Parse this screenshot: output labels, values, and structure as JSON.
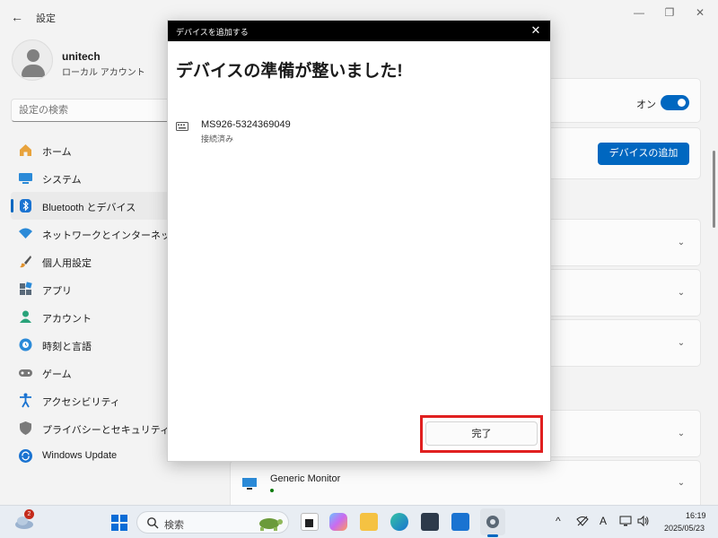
{
  "settings": {
    "app_title": "設定",
    "back_icon": "←",
    "minimize_icon": "—",
    "maximize_icon": "❐",
    "close_icon": "✕",
    "user": {
      "name": "unitech",
      "account_type": "ローカル アカウント"
    },
    "search_placeholder": "設定の検索",
    "nav": [
      {
        "label": "ホーム",
        "icon": "home-icon"
      },
      {
        "label": "システム",
        "icon": "system-icon"
      },
      {
        "label": "Bluetooth とデバイス",
        "icon": "bluetooth-icon",
        "active": true
      },
      {
        "label": "ネットワークとインターネット",
        "icon": "wifi-icon"
      },
      {
        "label": "個人用設定",
        "icon": "brush-icon"
      },
      {
        "label": "アプリ",
        "icon": "apps-icon"
      },
      {
        "label": "アカウント",
        "icon": "account-icon"
      },
      {
        "label": "時刻と言語",
        "icon": "globe-clock-icon"
      },
      {
        "label": "ゲーム",
        "icon": "gamepad-icon"
      },
      {
        "label": "アクセシビリティ",
        "icon": "accessibility-icon"
      },
      {
        "label": "プライバシーとセキュリティ",
        "icon": "shield-icon"
      },
      {
        "label": "Windows Update",
        "icon": "update-icon"
      }
    ],
    "bluetooth_toggle_label": "オン",
    "add_device_label": "デバイスの追加",
    "generic_monitor_label": "Generic Monitor"
  },
  "dialog": {
    "title": "デバイスを追加する",
    "close_icon": "✕",
    "heading": "デバイスの準備が整いました!",
    "device_name": "MS926-5324369049",
    "device_status": "接続済み",
    "done_label": "完了"
  },
  "taskbar": {
    "notification_count": "2",
    "search_label": "検索",
    "tray_chevron": "^",
    "ime_label": "A",
    "time": "16:19",
    "date": "2025/05/23"
  }
}
